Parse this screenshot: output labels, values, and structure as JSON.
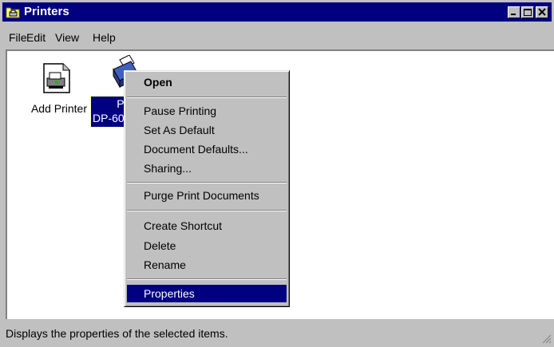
{
  "window": {
    "title": "Printers",
    "title_icon": "printers-folder-icon"
  },
  "menubar": {
    "file": "File",
    "edit": "Edit",
    "view": "View",
    "help": "Help"
  },
  "icons": {
    "add_printer": {
      "label": "Add Printer",
      "icon": "add-printer-icon"
    },
    "panasonic": {
      "line1": "Par",
      "line2": "DP-60",
      "icon": "printer-icon"
    }
  },
  "context_menu": {
    "items": [
      {
        "label": "Open",
        "default": true
      },
      {
        "label": "Pause Printing"
      },
      {
        "label": "Set As Default"
      },
      {
        "label": "Document Defaults..."
      },
      {
        "label": "Sharing..."
      },
      {
        "label": "Purge Print Documents"
      },
      {
        "label": "Create Shortcut"
      },
      {
        "label": "Delete"
      },
      {
        "label": "Rename"
      },
      {
        "label": "Properties",
        "selected": true
      }
    ]
  },
  "statusbar": {
    "text": "Displays the properties of the selected items."
  },
  "colors": {
    "face": "#c0c0c0",
    "titlebar": "#000080",
    "highlight": "#000080"
  }
}
